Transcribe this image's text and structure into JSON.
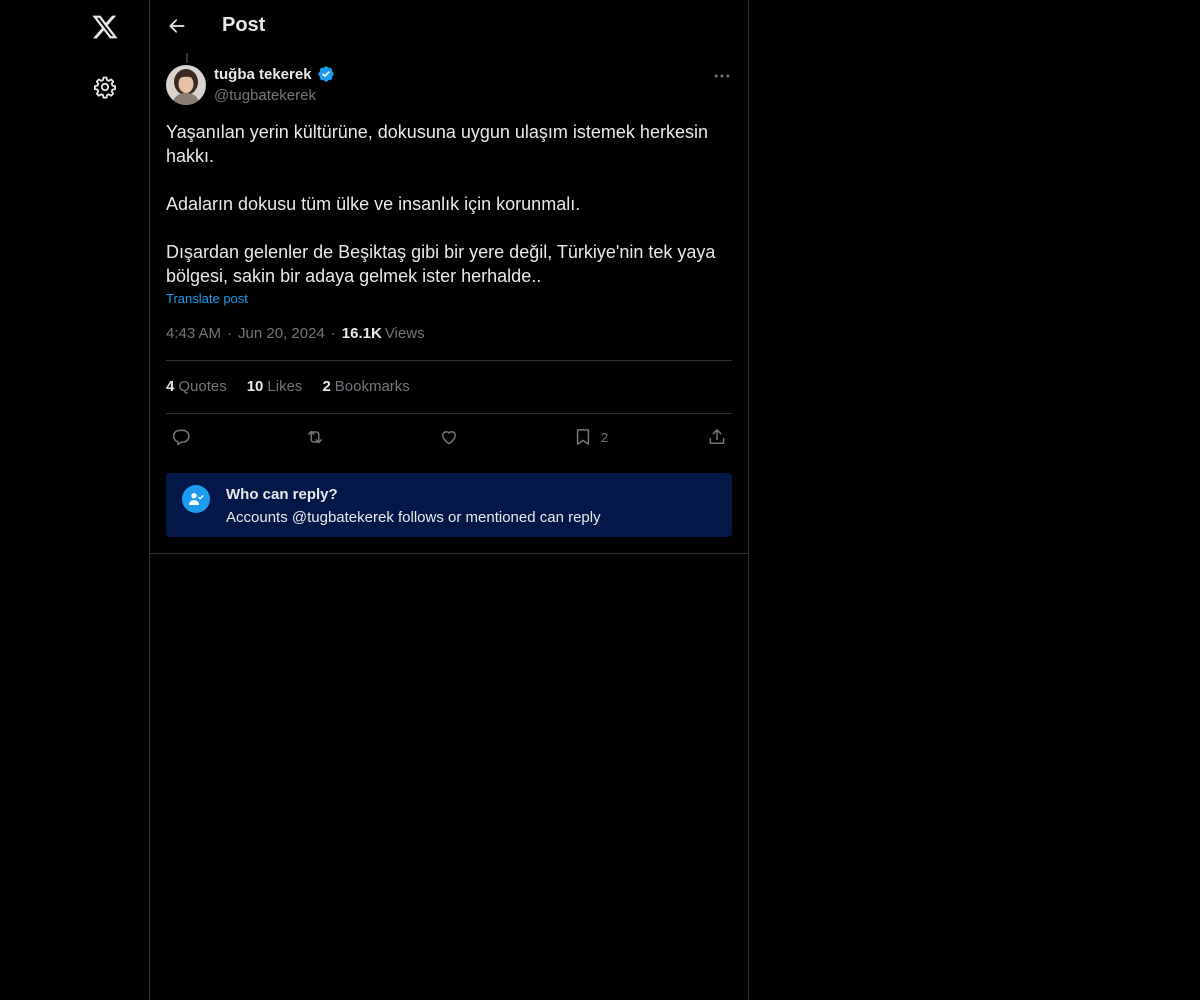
{
  "header": {
    "title": "Post"
  },
  "post": {
    "author_name": "tuğba tekerek",
    "author_handle": "@tugbatekerek",
    "paragraphs": [
      "Yaşanılan yerin kültürüne, dokusuna uygun ulaşım istemek herkesin hakkı.",
      "Adaların dokusu tüm ülke ve insanlık için korunmalı.",
      "Dışardan gelenler de Beşiktaş gibi bir yere değil, Türkiye'nin tek yaya bölgesi, sakin bir adaya gelmek ister herhalde.."
    ],
    "translate_label": "Translate post",
    "time": "4:43 AM",
    "date": "Jun 20, 2024",
    "views_count": "16.1K",
    "views_label": "Views"
  },
  "stats": {
    "quotes_count": "4",
    "quotes_label": "Quotes",
    "likes_count": "10",
    "likes_label": "Likes",
    "bookmarks_count": "2",
    "bookmarks_label": "Bookmarks"
  },
  "actions": {
    "bookmark_count": "2"
  },
  "reply_restriction": {
    "title": "Who can reply?",
    "description": "Accounts @tugbatekerek follows or mentioned can reply"
  },
  "icons": {
    "logo": "x-logo-icon",
    "settings": "gear-icon",
    "back": "arrow-left-icon",
    "verified": "verified-badge-icon",
    "more": "more-horizontal-icon",
    "reply": "reply-icon",
    "repost": "repost-icon",
    "like": "heart-icon",
    "bookmark": "bookmark-icon",
    "share": "share-icon",
    "reply_restriction": "user-check-icon"
  },
  "colors": {
    "background": "#000000",
    "accent": "#1d9bf0",
    "text_primary": "#e7e9ea",
    "text_secondary": "#71767b",
    "border": "#2f3336",
    "reply_box_bg": "#031849"
  }
}
